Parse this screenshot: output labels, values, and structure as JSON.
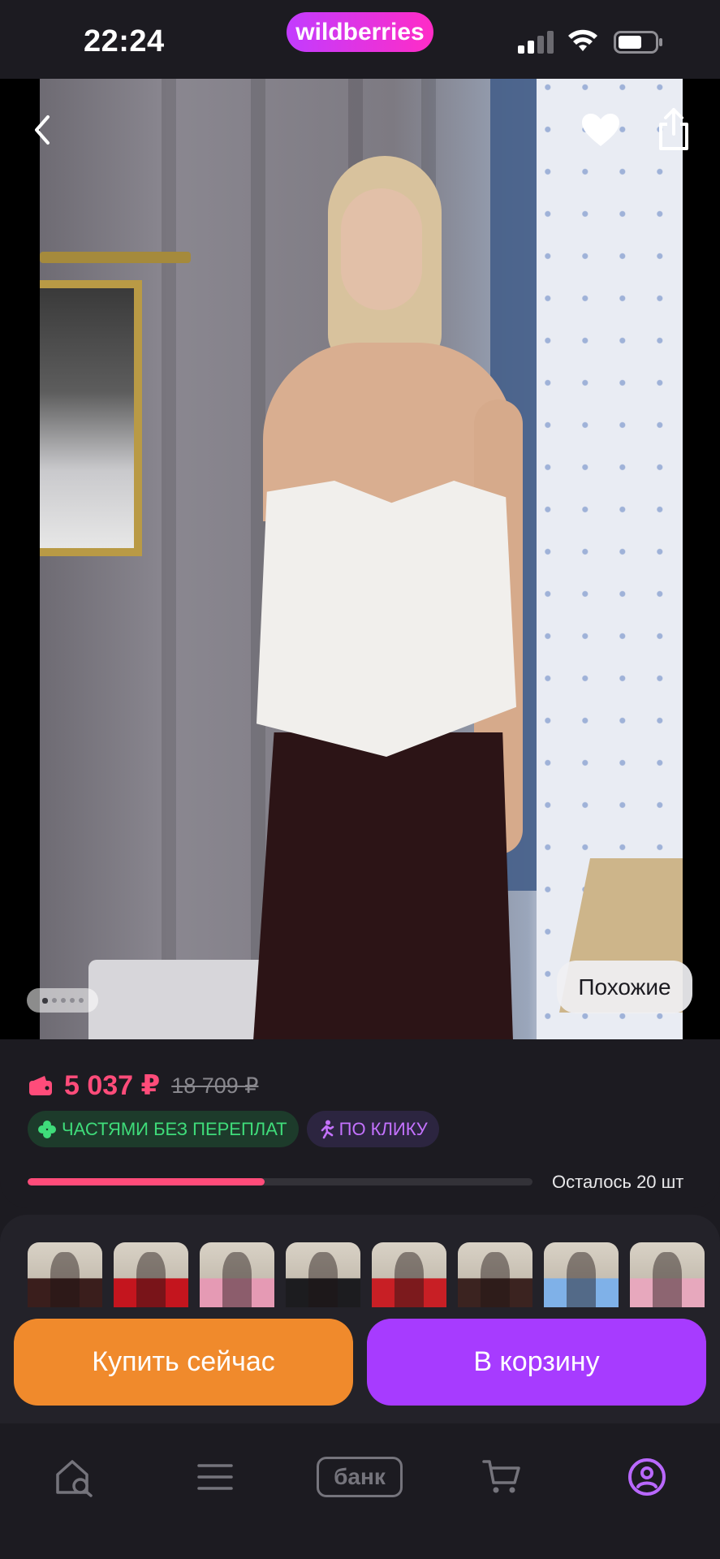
{
  "status_bar": {
    "time": "22:24",
    "brand": "wildberries",
    "brand_colors": [
      "#c23cff",
      "#ff2cc6"
    ],
    "icons": [
      "signal-icon",
      "wifi-icon",
      "battery-icon"
    ]
  },
  "gallery": {
    "icons": [
      "back-arrow-icon",
      "heart-icon",
      "share-icon"
    ],
    "similar_label": "Похожие",
    "dots_count": 5,
    "active_dot": 0
  },
  "price": {
    "icon": "wallet-icon",
    "current": "5 037 ₽",
    "old": "18 709 ₽",
    "accent_color": "#ff4c7a"
  },
  "badges": [
    {
      "icon": "clover-icon",
      "label": "ЧАСТЯМИ БЕЗ ПЕРЕПЛАТ"
    },
    {
      "icon": "running-person-icon",
      "label": "ПО КЛИКУ"
    }
  ],
  "stock": {
    "label": "Осталось 20 шт",
    "progress_fraction": 0.47
  },
  "thumbnails": [
    {
      "dress_color": "#3a1e1c"
    },
    {
      "dress_color": "#c4151e"
    },
    {
      "dress_color": "#e59ab4"
    },
    {
      "dress_color": "#1c1c1f"
    },
    {
      "dress_color": "#c81f25"
    },
    {
      "dress_color": "#3b2320"
    },
    {
      "dress_color": "#7fb1e8"
    },
    {
      "dress_color": "#e7a8bd"
    }
  ],
  "actions": {
    "buy_now": "Купить сейчас",
    "add_to_cart": "В корзину",
    "buy_color": "#f08a2c",
    "cart_color": "#a73bff"
  },
  "tabbar": {
    "items": [
      "home-search-icon",
      "menu-icon",
      "bank-icon",
      "cart-icon",
      "profile-icon"
    ],
    "bank_label": "банк",
    "active": "profile-icon"
  }
}
